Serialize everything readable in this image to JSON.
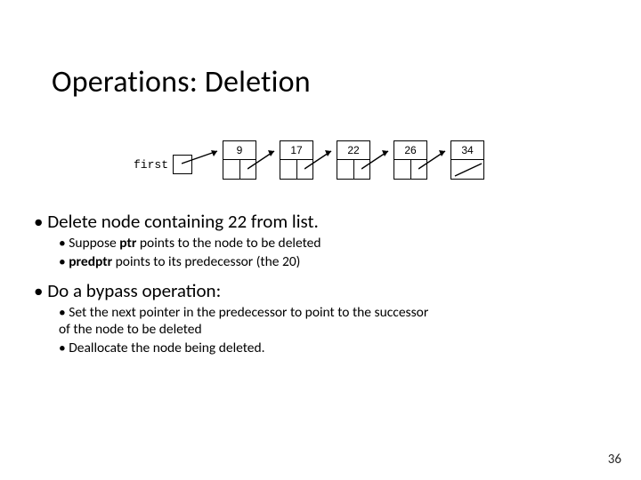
{
  "title": "Operations: Deletion",
  "diagram": {
    "first_label": "first",
    "nodes": [
      "9",
      "17",
      "22",
      "26",
      "34"
    ]
  },
  "bullets": {
    "l1a": "Delete node containing 22 from list.",
    "l1a_sub1_pre": "Suppose ",
    "l1a_sub1_b": "ptr",
    "l1a_sub1_post": " points to the node to be deleted",
    "l1a_sub2_b": "predptr",
    "l1a_sub2_post": " points to its predecessor (the 20)",
    "l1b": "Do a bypass operation:",
    "l1b_sub1": "Set the next pointer in the predecessor to point to the successor of the node to be deleted",
    "l1b_sub2": "Deallocate the node being deleted."
  },
  "page_number": "36"
}
